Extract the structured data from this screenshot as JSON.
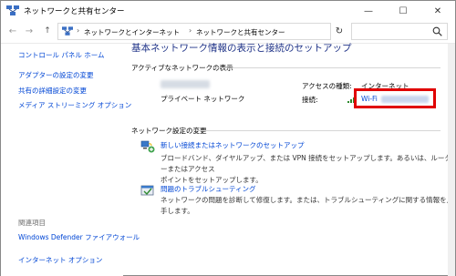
{
  "window": {
    "title": "ネットワークと共有センター",
    "minimize_glyph": "—",
    "maximize_glyph": "☐",
    "close_glyph": "✕"
  },
  "nav": {
    "back_glyph": "←",
    "forward_glyph": "→",
    "up_glyph": "↑",
    "refresh_glyph": "↻",
    "dropdown_glyph": "⌄"
  },
  "breadcrumb": [
    "ネットワークとインターネット",
    "ネットワークと共有センター"
  ],
  "sidebar": {
    "items": [
      "コントロール パネル ホーム",
      "アダプターの設定の変更",
      "共有の詳細設定の変更",
      "メディア ストリーミング オプション"
    ],
    "related_heading": "関連項目",
    "related_items": [
      "Windows Defender ファイアウォール",
      "インターネット オプション"
    ]
  },
  "main": {
    "title": "基本ネットワーク情報の表示と接続のセットアップ",
    "active_networks_label": "アクティブなネットワークの表示",
    "network_type": "プライベート ネットワーク",
    "access_type_label": "アクセスの種類:",
    "access_type_value": "インターネット",
    "connection_label": "接続:",
    "connection_value": "Wi-Fi",
    "change_settings_label": "ネットワーク設定の変更",
    "tasks": [
      {
        "title": "新しい接続またはネットワークのセットアップ",
        "desc_line1": "ブロードバンド、ダイヤルアップ、または VPN 接続をセットアップします。あるいは、ルーターまたはアクセス",
        "desc_line2": "ポイントをセットアップします。",
        "icon": "network-setup-icon"
      },
      {
        "title": "問題のトラブルシューティング",
        "desc_line1": "ネットワークの問題を診断して修復します。または、トラブルシューティングに関する情報を入手します。",
        "icon": "troubleshoot-icon"
      }
    ]
  },
  "colors": {
    "link": "#0046d5",
    "title": "#1e3287",
    "highlight": "#e00000"
  }
}
